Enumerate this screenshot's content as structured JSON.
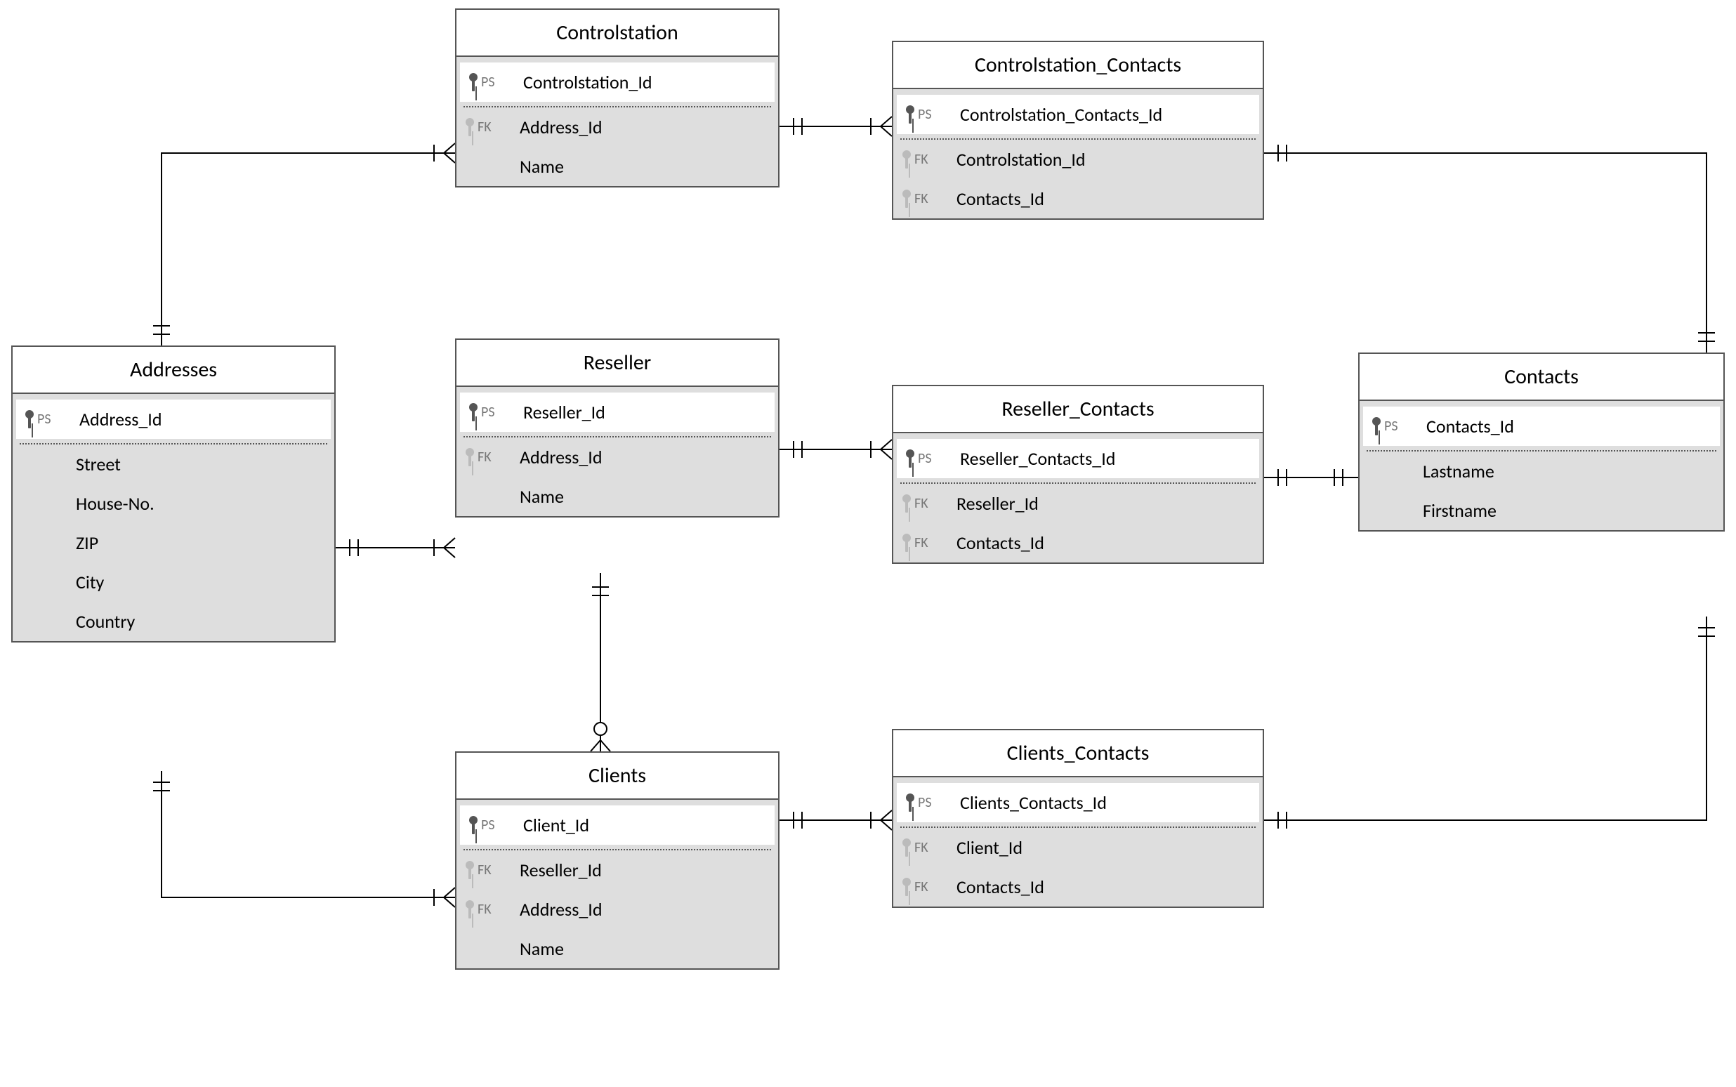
{
  "entities": {
    "addresses": {
      "title": "Addresses",
      "pk_label": "PS",
      "pk_field": "Address_Id",
      "fields": [
        {
          "key": "",
          "name": "Street"
        },
        {
          "key": "",
          "name": "House-No."
        },
        {
          "key": "",
          "name": "ZIP"
        },
        {
          "key": "",
          "name": "City"
        },
        {
          "key": "",
          "name": "Country"
        }
      ]
    },
    "controlstation": {
      "title": "Controlstation",
      "pk_label": "PS",
      "pk_field": "Controlstation_Id",
      "fields": [
        {
          "key": "FK",
          "name": "Address_Id"
        },
        {
          "key": "",
          "name": "Name"
        }
      ]
    },
    "reseller": {
      "title": "Reseller",
      "pk_label": "PS",
      "pk_field": "Reseller_Id",
      "fields": [
        {
          "key": "FK",
          "name": "Address_Id"
        },
        {
          "key": "",
          "name": "Name"
        }
      ]
    },
    "clients": {
      "title": "Clients",
      "pk_label": "PS",
      "pk_field": "Client_Id",
      "fields": [
        {
          "key": "FK",
          "name": "Reseller_Id"
        },
        {
          "key": "FK",
          "name": "Address_Id"
        },
        {
          "key": "",
          "name": "Name"
        }
      ]
    },
    "controlstation_contacts": {
      "title": "Controlstation_Contacts",
      "pk_label": "PS",
      "pk_field": "Controlstation_Contacts_Id",
      "fields": [
        {
          "key": "FK",
          "name": "Controlstation_Id"
        },
        {
          "key": "FK",
          "name": "Contacts_Id"
        }
      ]
    },
    "reseller_contacts": {
      "title": "Reseller_Contacts",
      "pk_label": "PS",
      "pk_field": "Reseller_Contacts_Id",
      "fields": [
        {
          "key": "FK",
          "name": "Reseller_Id"
        },
        {
          "key": "FK",
          "name": "Contacts_Id"
        }
      ]
    },
    "clients_contacts": {
      "title": "Clients_Contacts",
      "pk_label": "PS",
      "pk_field": "Clients_Contacts_Id",
      "fields": [
        {
          "key": "FK",
          "name": "Client_Id"
        },
        {
          "key": "FK",
          "name": "Contacts_Id"
        }
      ]
    },
    "contacts": {
      "title": "Contacts",
      "pk_label": "PS",
      "pk_field": "Contacts_Id",
      "fields": [
        {
          "key": "",
          "name": "Lastname"
        },
        {
          "key": "",
          "name": "Firstname"
        }
      ]
    }
  }
}
